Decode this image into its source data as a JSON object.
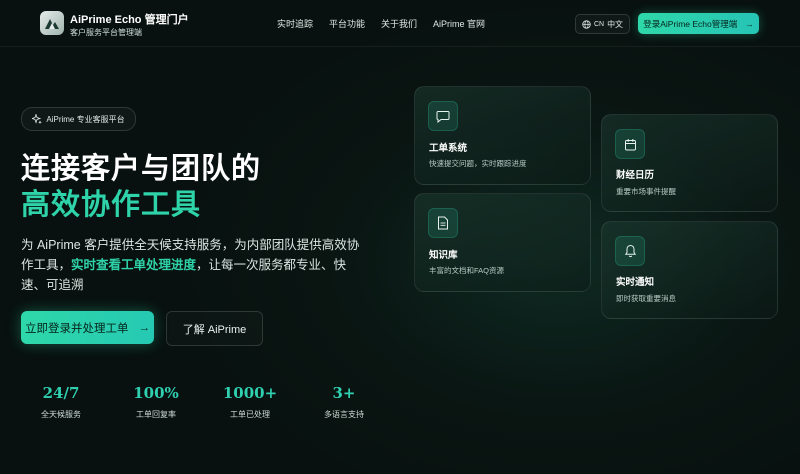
{
  "header": {
    "brand_title": "AiPrime Echo 管理门户",
    "brand_subtitle": "客户服务平台管理端",
    "nav": [
      "实时追踪",
      "平台功能",
      "关于我们",
      "AiPrime 官网"
    ],
    "lang_code": "CN",
    "lang_label": "中文",
    "login_label": "登录AiPrime Echo管理端"
  },
  "hero": {
    "badge": "AiPrime 专业客服平台",
    "title_line1": "连接客户与团队的",
    "title_line2": "高效协作工具",
    "desc_before": "为 AiPrime 客户提供全天候支持服务，为内部团队提供高效协作工具，",
    "desc_highlight": "实时查看工单处理进度",
    "desc_after": "，让每一次服务都专业、快速、可追溯",
    "cta_primary": "立即登录并处理工单",
    "cta_secondary": "了解 AiPrime"
  },
  "stats": [
    {
      "value": "24/7",
      "label": "全天候服务"
    },
    {
      "value": "100%",
      "label": "工单回复率"
    },
    {
      "value": "1000+",
      "label": "工单已处理"
    },
    {
      "value": "3+",
      "label": "多语言支持"
    }
  ],
  "cards": [
    {
      "icon": "message-icon",
      "title": "工单系统",
      "subtitle": "快速提交问题，实时跟踪进度"
    },
    {
      "icon": "calendar-icon",
      "title": "财经日历",
      "subtitle": "重要市场事件提醒"
    },
    {
      "icon": "document-icon",
      "title": "知识库",
      "subtitle": "丰富的文档和FAQ资源"
    },
    {
      "icon": "bell-icon",
      "title": "实时通知",
      "subtitle": "即时获取重要消息"
    }
  ],
  "colors": {
    "accent": "#2fd3a9",
    "background": "#0a1613"
  }
}
